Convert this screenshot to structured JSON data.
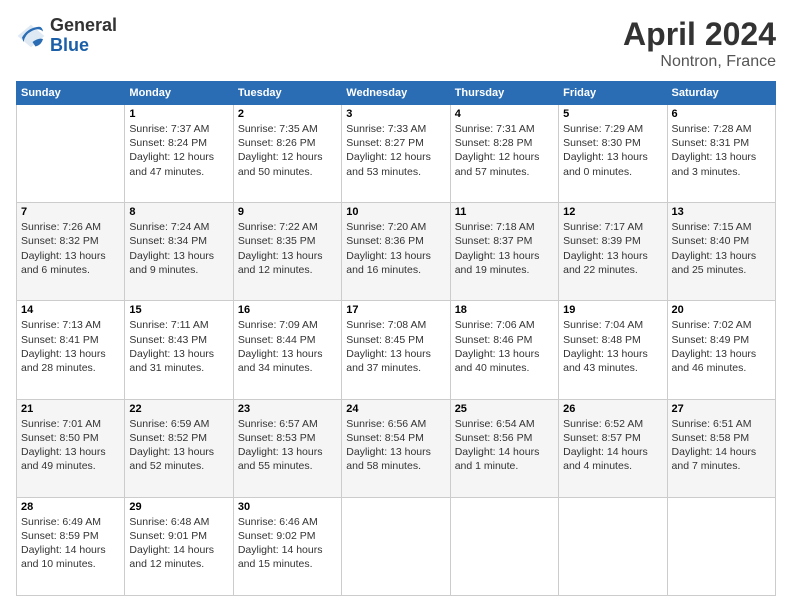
{
  "logo": {
    "general": "General",
    "blue": "Blue"
  },
  "title": {
    "month_year": "April 2024",
    "location": "Nontron, France"
  },
  "header_days": [
    "Sunday",
    "Monday",
    "Tuesday",
    "Wednesday",
    "Thursday",
    "Friday",
    "Saturday"
  ],
  "weeks": [
    [
      {
        "day": "",
        "sunrise": "",
        "sunset": "",
        "daylight": ""
      },
      {
        "day": "1",
        "sunrise": "Sunrise: 7:37 AM",
        "sunset": "Sunset: 8:24 PM",
        "daylight": "Daylight: 12 hours and 47 minutes."
      },
      {
        "day": "2",
        "sunrise": "Sunrise: 7:35 AM",
        "sunset": "Sunset: 8:26 PM",
        "daylight": "Daylight: 12 hours and 50 minutes."
      },
      {
        "day": "3",
        "sunrise": "Sunrise: 7:33 AM",
        "sunset": "Sunset: 8:27 PM",
        "daylight": "Daylight: 12 hours and 53 minutes."
      },
      {
        "day": "4",
        "sunrise": "Sunrise: 7:31 AM",
        "sunset": "Sunset: 8:28 PM",
        "daylight": "Daylight: 12 hours and 57 minutes."
      },
      {
        "day": "5",
        "sunrise": "Sunrise: 7:29 AM",
        "sunset": "Sunset: 8:30 PM",
        "daylight": "Daylight: 13 hours and 0 minutes."
      },
      {
        "day": "6",
        "sunrise": "Sunrise: 7:28 AM",
        "sunset": "Sunset: 8:31 PM",
        "daylight": "Daylight: 13 hours and 3 minutes."
      }
    ],
    [
      {
        "day": "7",
        "sunrise": "Sunrise: 7:26 AM",
        "sunset": "Sunset: 8:32 PM",
        "daylight": "Daylight: 13 hours and 6 minutes."
      },
      {
        "day": "8",
        "sunrise": "Sunrise: 7:24 AM",
        "sunset": "Sunset: 8:34 PM",
        "daylight": "Daylight: 13 hours and 9 minutes."
      },
      {
        "day": "9",
        "sunrise": "Sunrise: 7:22 AM",
        "sunset": "Sunset: 8:35 PM",
        "daylight": "Daylight: 13 hours and 12 minutes."
      },
      {
        "day": "10",
        "sunrise": "Sunrise: 7:20 AM",
        "sunset": "Sunset: 8:36 PM",
        "daylight": "Daylight: 13 hours and 16 minutes."
      },
      {
        "day": "11",
        "sunrise": "Sunrise: 7:18 AM",
        "sunset": "Sunset: 8:37 PM",
        "daylight": "Daylight: 13 hours and 19 minutes."
      },
      {
        "day": "12",
        "sunrise": "Sunrise: 7:17 AM",
        "sunset": "Sunset: 8:39 PM",
        "daylight": "Daylight: 13 hours and 22 minutes."
      },
      {
        "day": "13",
        "sunrise": "Sunrise: 7:15 AM",
        "sunset": "Sunset: 8:40 PM",
        "daylight": "Daylight: 13 hours and 25 minutes."
      }
    ],
    [
      {
        "day": "14",
        "sunrise": "Sunrise: 7:13 AM",
        "sunset": "Sunset: 8:41 PM",
        "daylight": "Daylight: 13 hours and 28 minutes."
      },
      {
        "day": "15",
        "sunrise": "Sunrise: 7:11 AM",
        "sunset": "Sunset: 8:43 PM",
        "daylight": "Daylight: 13 hours and 31 minutes."
      },
      {
        "day": "16",
        "sunrise": "Sunrise: 7:09 AM",
        "sunset": "Sunset: 8:44 PM",
        "daylight": "Daylight: 13 hours and 34 minutes."
      },
      {
        "day": "17",
        "sunrise": "Sunrise: 7:08 AM",
        "sunset": "Sunset: 8:45 PM",
        "daylight": "Daylight: 13 hours and 37 minutes."
      },
      {
        "day": "18",
        "sunrise": "Sunrise: 7:06 AM",
        "sunset": "Sunset: 8:46 PM",
        "daylight": "Daylight: 13 hours and 40 minutes."
      },
      {
        "day": "19",
        "sunrise": "Sunrise: 7:04 AM",
        "sunset": "Sunset: 8:48 PM",
        "daylight": "Daylight: 13 hours and 43 minutes."
      },
      {
        "day": "20",
        "sunrise": "Sunrise: 7:02 AM",
        "sunset": "Sunset: 8:49 PM",
        "daylight": "Daylight: 13 hours and 46 minutes."
      }
    ],
    [
      {
        "day": "21",
        "sunrise": "Sunrise: 7:01 AM",
        "sunset": "Sunset: 8:50 PM",
        "daylight": "Daylight: 13 hours and 49 minutes."
      },
      {
        "day": "22",
        "sunrise": "Sunrise: 6:59 AM",
        "sunset": "Sunset: 8:52 PM",
        "daylight": "Daylight: 13 hours and 52 minutes."
      },
      {
        "day": "23",
        "sunrise": "Sunrise: 6:57 AM",
        "sunset": "Sunset: 8:53 PM",
        "daylight": "Daylight: 13 hours and 55 minutes."
      },
      {
        "day": "24",
        "sunrise": "Sunrise: 6:56 AM",
        "sunset": "Sunset: 8:54 PM",
        "daylight": "Daylight: 13 hours and 58 minutes."
      },
      {
        "day": "25",
        "sunrise": "Sunrise: 6:54 AM",
        "sunset": "Sunset: 8:56 PM",
        "daylight": "Daylight: 14 hours and 1 minute."
      },
      {
        "day": "26",
        "sunrise": "Sunrise: 6:52 AM",
        "sunset": "Sunset: 8:57 PM",
        "daylight": "Daylight: 14 hours and 4 minutes."
      },
      {
        "day": "27",
        "sunrise": "Sunrise: 6:51 AM",
        "sunset": "Sunset: 8:58 PM",
        "daylight": "Daylight: 14 hours and 7 minutes."
      }
    ],
    [
      {
        "day": "28",
        "sunrise": "Sunrise: 6:49 AM",
        "sunset": "Sunset: 8:59 PM",
        "daylight": "Daylight: 14 hours and 10 minutes."
      },
      {
        "day": "29",
        "sunrise": "Sunrise: 6:48 AM",
        "sunset": "Sunset: 9:01 PM",
        "daylight": "Daylight: 14 hours and 12 minutes."
      },
      {
        "day": "30",
        "sunrise": "Sunrise: 6:46 AM",
        "sunset": "Sunset: 9:02 PM",
        "daylight": "Daylight: 14 hours and 15 minutes."
      },
      {
        "day": "",
        "sunrise": "",
        "sunset": "",
        "daylight": ""
      },
      {
        "day": "",
        "sunrise": "",
        "sunset": "",
        "daylight": ""
      },
      {
        "day": "",
        "sunrise": "",
        "sunset": "",
        "daylight": ""
      },
      {
        "day": "",
        "sunrise": "",
        "sunset": "",
        "daylight": ""
      }
    ]
  ]
}
